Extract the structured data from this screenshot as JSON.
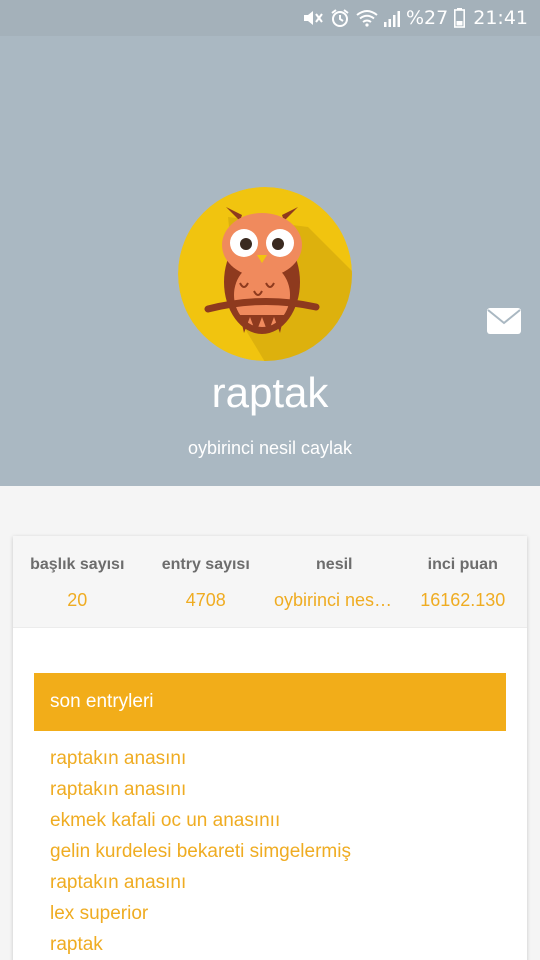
{
  "status_bar": {
    "battery": "%27",
    "time": "21:41",
    "icons": [
      "mute-icon",
      "alarm-icon",
      "wifi-icon",
      "signal-icon",
      "battery-icon"
    ]
  },
  "profile": {
    "username": "raptak",
    "rank": "oybirinci nesil caylak",
    "avatar": "owl-avatar",
    "message_icon": "envelope-icon",
    "colors": {
      "header_bg": "#aab8c2",
      "avatar_bg": "#f1c40f",
      "accent": "#efac22"
    }
  },
  "stats": [
    {
      "label": "başlık sayısı",
      "value": "20"
    },
    {
      "label": "entry sayısı",
      "value": "4708"
    },
    {
      "label": "nesil",
      "value": "oybirinci nesil caylak"
    },
    {
      "label": "inci puan",
      "value": "16162.130"
    }
  ],
  "recent_entries": {
    "title": "son entryleri",
    "items": [
      "raptakın anasını",
      "raptakın anasını",
      "ekmek kafali oc un anasınıı",
      "gelin kurdelesi bekareti simgelermiş",
      "raptakın anasını",
      "lex superior",
      "raptak"
    ]
  }
}
